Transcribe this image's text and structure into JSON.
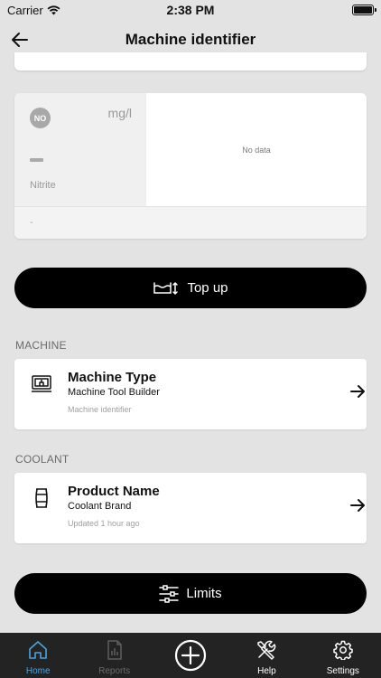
{
  "status_bar": {
    "carrier": "Carrier",
    "time": "2:38 PM"
  },
  "nav": {
    "title": "Machine identifier",
    "back_icon": "arrow-left-icon"
  },
  "parameter": {
    "badge": "NO",
    "unit": "mg/l",
    "value": "—",
    "name": "Nitrite",
    "no_data": "No data",
    "footer": "-"
  },
  "top_up_button": {
    "label": "Top up",
    "icon": "level-icon"
  },
  "machine_section": {
    "heading": "MACHINE",
    "title": "Machine Type",
    "subtitle": "Machine Tool Builder",
    "detail": "Machine identifier",
    "icon": "machine-icon"
  },
  "coolant_section": {
    "heading": "COOLANT",
    "title": "Product Name",
    "subtitle": "Coolant Brand",
    "detail": "Updated 1 hour ago",
    "icon": "barrel-icon"
  },
  "limits_button": {
    "label": "Limits",
    "icon": "sliders-icon"
  },
  "tabbar": {
    "tabs": [
      {
        "label": "Home",
        "icon": "home-icon",
        "state": "active"
      },
      {
        "label": "Reports",
        "icon": "report-icon",
        "state": "disabled"
      },
      {
        "label": "",
        "icon": "add-icon",
        "state": "normal"
      },
      {
        "label": "Help",
        "icon": "tools-icon",
        "state": "normal"
      },
      {
        "label": "Settings",
        "icon": "gear-icon",
        "state": "normal"
      }
    ]
  },
  "colors": {
    "background": "#e3e3e3",
    "tabbar": "#232323",
    "active_tab": "#4aa3df",
    "button": "#000000"
  }
}
